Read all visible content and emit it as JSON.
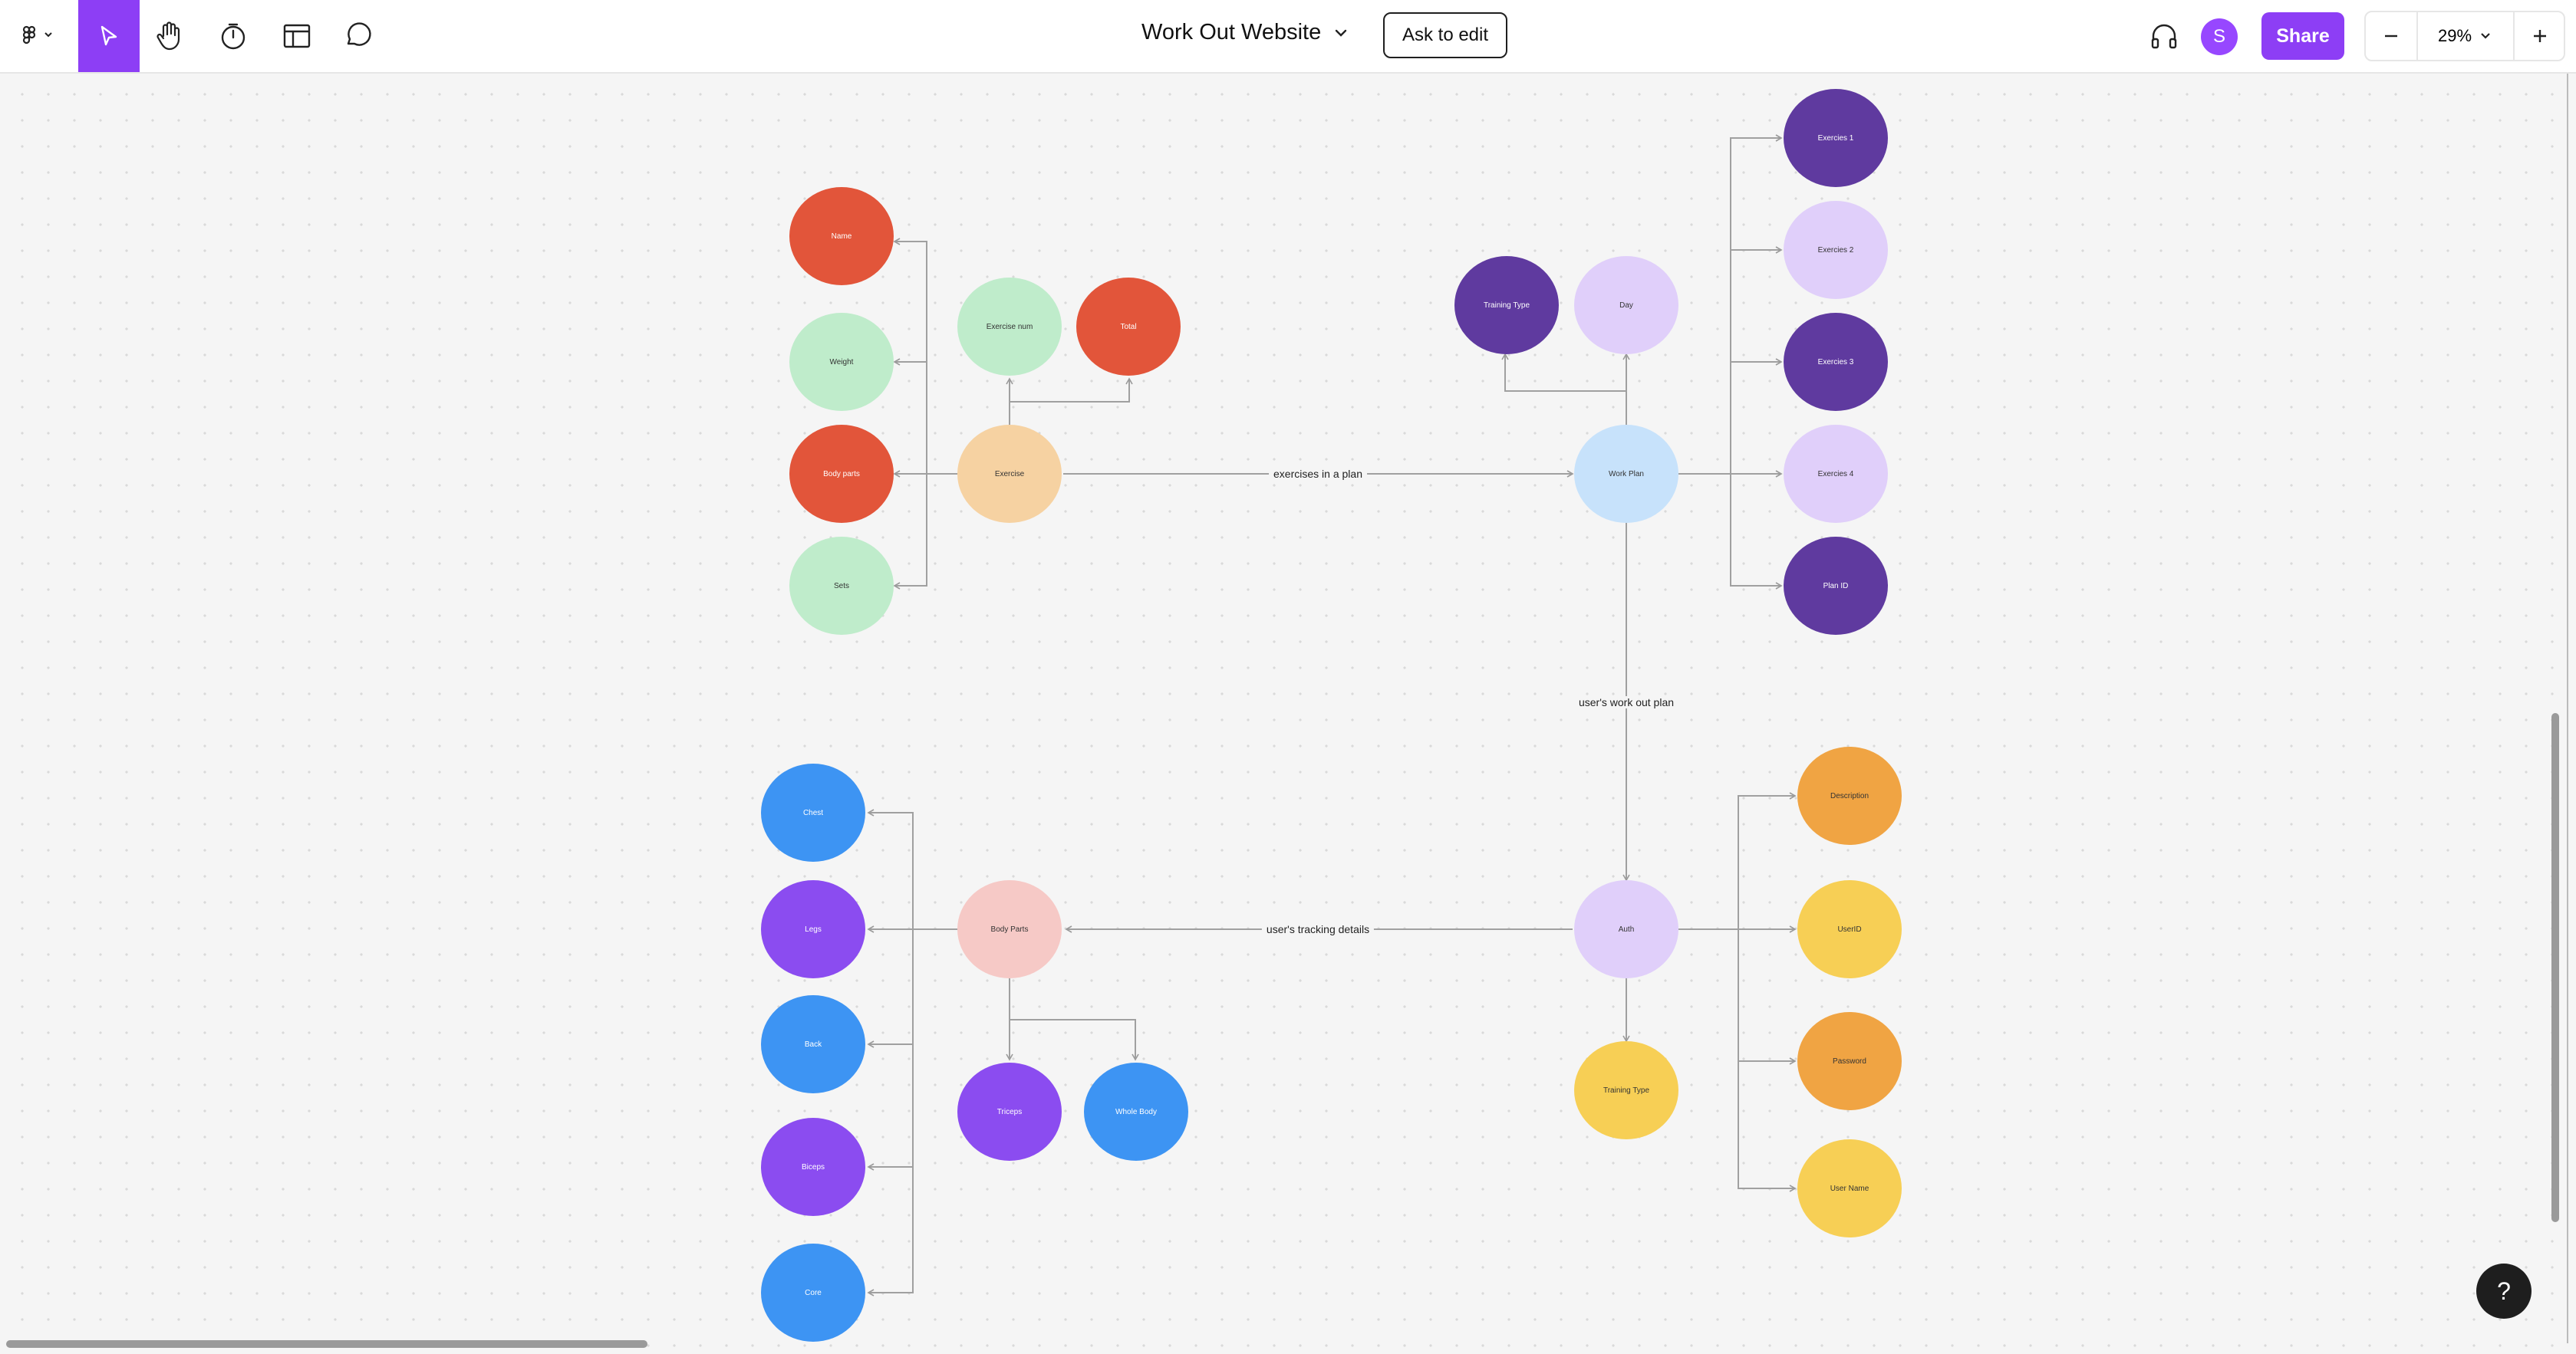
{
  "toolbar": {
    "file_title": "Work Out Website",
    "ask_to_edit": "Ask to edit",
    "share": "Share",
    "avatar_initial": "S",
    "zoom": "29%",
    "icons": [
      "figma-menu-icon",
      "move-tool-icon",
      "hand-tool-icon",
      "timer-icon",
      "layout-icon",
      "comment-icon",
      "headphones-icon",
      "minus-icon",
      "plus-icon"
    ],
    "accent": "#8d3ef5"
  },
  "nodes": [
    {
      "id": "name",
      "label": "Name",
      "color": "#e2553a",
      "text": "#ffffff"
    },
    {
      "id": "weight",
      "label": "Weight",
      "color": "#bfeccb",
      "text": "#333333"
    },
    {
      "id": "body-parts-attr",
      "label": "Body parts",
      "color": "#e2553a",
      "text": "#ffffff"
    },
    {
      "id": "sets",
      "label": "Sets",
      "color": "#bfeccb",
      "text": "#333333"
    },
    {
      "id": "exercise-num",
      "label": "Exercise num",
      "color": "#bfeccb",
      "text": "#333333"
    },
    {
      "id": "total",
      "label": "Total",
      "color": "#e2553a",
      "text": "#ffffff"
    },
    {
      "id": "exercise",
      "label": "Exercise",
      "color": "#f6d2a2",
      "text": "#333333"
    },
    {
      "id": "training-type-plan",
      "label": "Training Type",
      "color": "#5f3a9f",
      "text": "#ffffff"
    },
    {
      "id": "day",
      "label": "Day",
      "color": "#e0cffa",
      "text": "#333333"
    },
    {
      "id": "work-plan",
      "label": "Work Plan",
      "color": "#c7e2fb",
      "text": "#333333"
    },
    {
      "id": "exercise-1",
      "label": "Exercies 1",
      "color": "#5f3a9f",
      "text": "#ffffff"
    },
    {
      "id": "exercise-2",
      "label": "Exercies 2",
      "color": "#e0cffa",
      "text": "#333333"
    },
    {
      "id": "exercise-3",
      "label": "Exercies 3",
      "color": "#5f3a9f",
      "text": "#ffffff"
    },
    {
      "id": "exercise-4",
      "label": "Exercies 4",
      "color": "#e0cffa",
      "text": "#333333"
    },
    {
      "id": "plan-id",
      "label": "Plan ID",
      "color": "#5f3a9f",
      "text": "#ffffff"
    },
    {
      "id": "chest",
      "label": "Chest",
      "color": "#3d94f3",
      "text": "#ffffff"
    },
    {
      "id": "legs",
      "label": "Legs",
      "color": "#8b4cf0",
      "text": "#ffffff"
    },
    {
      "id": "back",
      "label": "Back",
      "color": "#3d94f3",
      "text": "#ffffff"
    },
    {
      "id": "biceps",
      "label": "Biceps",
      "color": "#8b4cf0",
      "text": "#ffffff"
    },
    {
      "id": "core",
      "label": "Core",
      "color": "#3d94f3",
      "text": "#ffffff"
    },
    {
      "id": "body-parts",
      "label": "Body Parts",
      "color": "#f6c9c6",
      "text": "#333333"
    },
    {
      "id": "triceps",
      "label": "Triceps",
      "color": "#8b4cf0",
      "text": "#ffffff"
    },
    {
      "id": "whole-body",
      "label": "Whole Body",
      "color": "#3d94f3",
      "text": "#ffffff"
    },
    {
      "id": "auth",
      "label": "Auth",
      "color": "#e0cffa",
      "text": "#333333"
    },
    {
      "id": "training-type-auth",
      "label": "Training Type",
      "color": "#f7cf55",
      "text": "#333333"
    },
    {
      "id": "description",
      "label": "Description",
      "color": "#f0a443",
      "text": "#333333"
    },
    {
      "id": "user-id",
      "label": "UserID",
      "color": "#f7cf55",
      "text": "#333333"
    },
    {
      "id": "password",
      "label": "Password",
      "color": "#f0a443",
      "text": "#333333"
    },
    {
      "id": "user-name",
      "label": "User Name",
      "color": "#f7cf55",
      "text": "#333333"
    }
  ],
  "edge_labels": {
    "exercises_in_plan": "exercises in a plan",
    "users_work_out_plan": "user's work out plan",
    "users_tracking_details": "user's tracking details"
  },
  "help": "?"
}
